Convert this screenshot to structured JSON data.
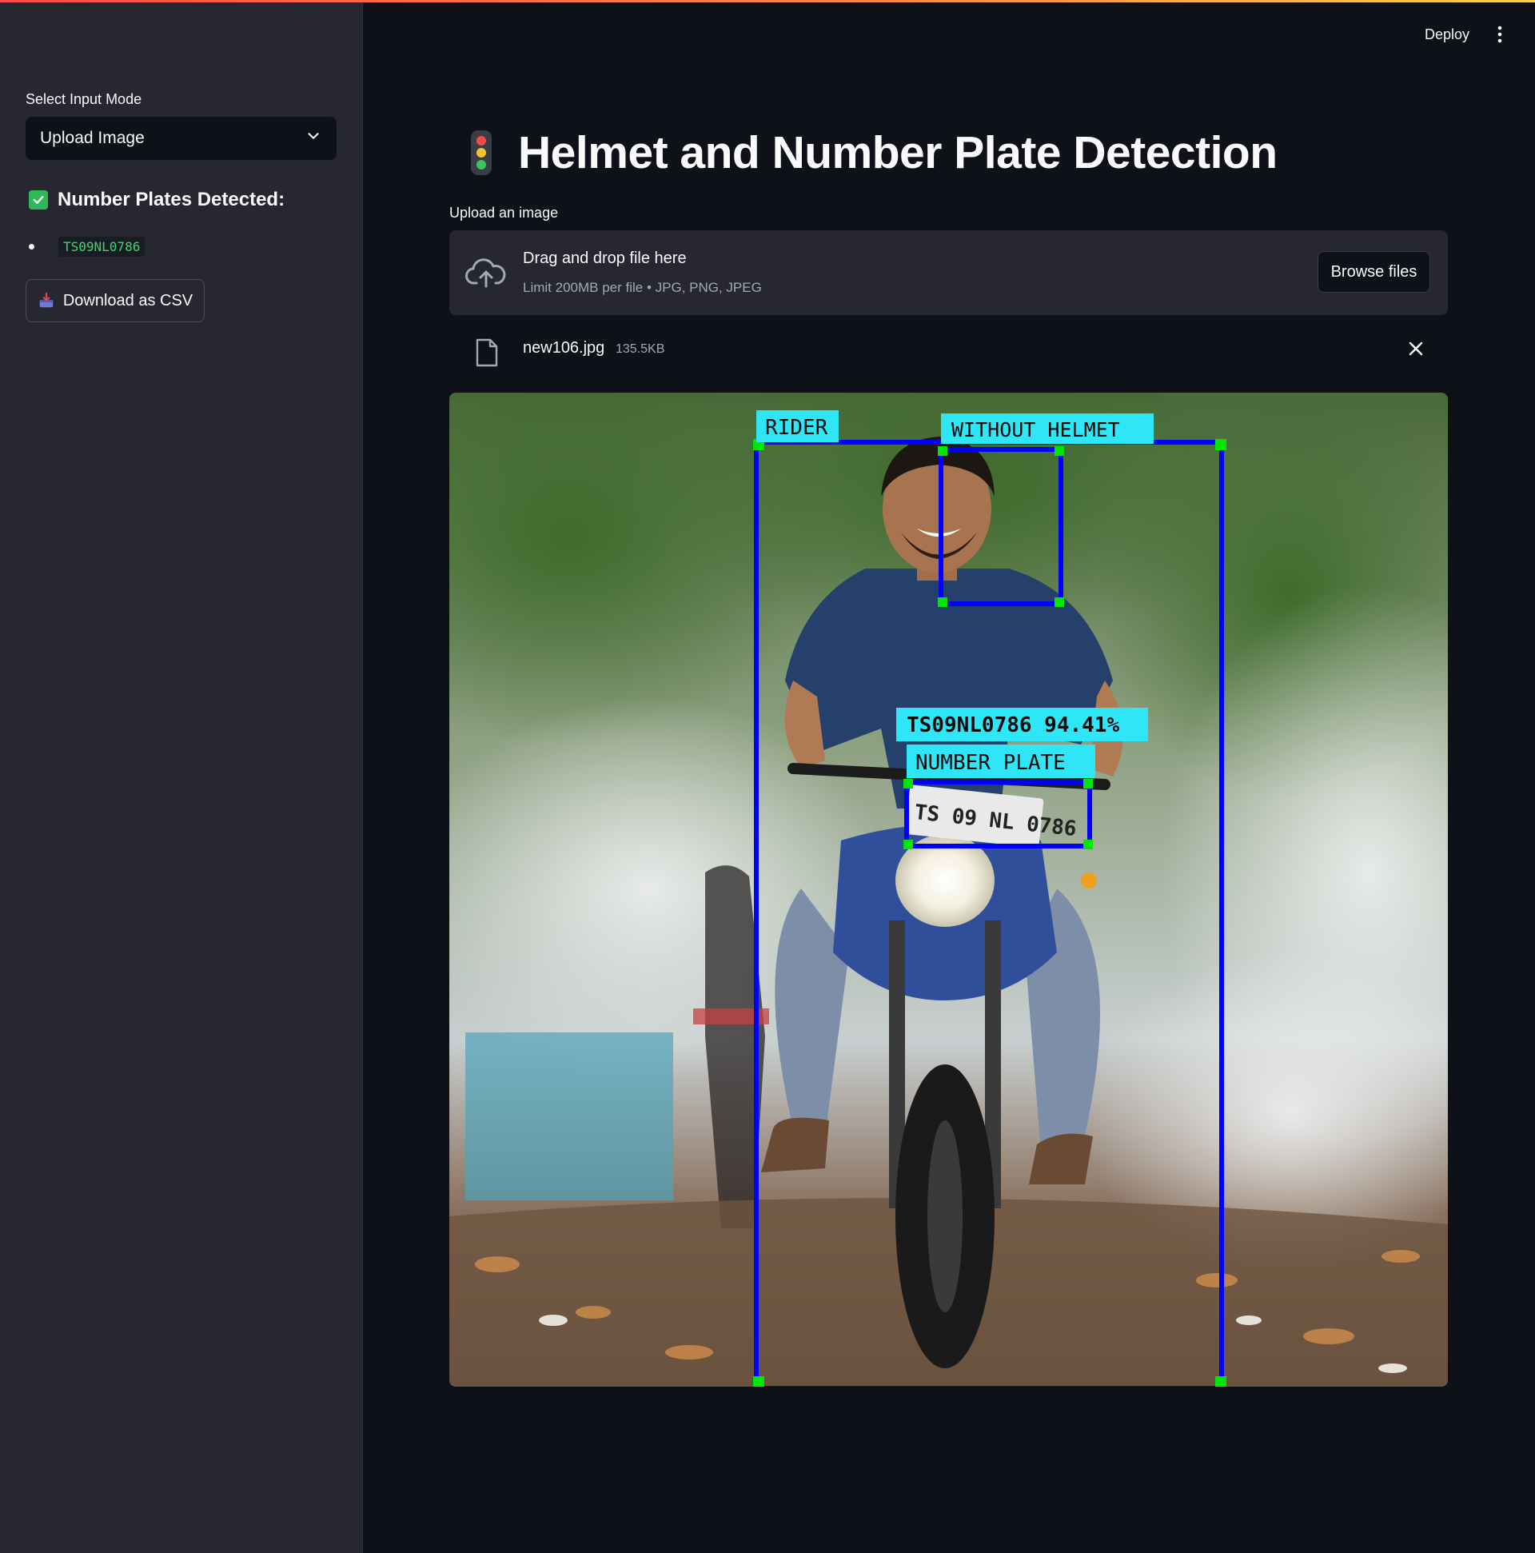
{
  "sidebar": {
    "input_mode_label": "Select Input Mode",
    "input_mode_value": "Upload Image",
    "plates_header": "Number Plates Detected:",
    "plates": [
      "TS09NL0786"
    ],
    "download_label": "Download as CSV"
  },
  "header": {
    "deploy_label": "Deploy"
  },
  "main": {
    "title": "Helmet and Number Plate Detection",
    "upload_label": "Upload an image",
    "dropzone": {
      "title": "Drag and drop file here",
      "subtitle": "Limit 200MB per file • JPG, PNG, JPEG",
      "browse_label": "Browse files"
    },
    "file": {
      "name": "new106.jpg",
      "size": "135.5KB"
    },
    "detections": {
      "rider_label": "RIDER",
      "helmet_label": "WITHOUT HELMET",
      "plate_reading": "TS09NL0786  94.41%",
      "plate_label": "NUMBER PLATE",
      "plate_text_in_image": "TS 09 NL 0786"
    }
  },
  "colors": {
    "app_bg": "#0e1117",
    "sidebar_bg": "#262730",
    "box_blue": "#0000ff",
    "corner_green": "#00e600",
    "label_cyan": "#2ee6f5",
    "plate_code_green": "#3dd56d",
    "check_green": "#2fb85a"
  },
  "icons": {
    "select": "chevron-down-icon",
    "check": "check-box-icon",
    "download": "inbox-tray-icon",
    "menu": "vertical-dots-icon",
    "title": "traffic-light-icon",
    "upload": "cloud-upload-icon",
    "file": "file-icon",
    "remove": "close-icon"
  }
}
